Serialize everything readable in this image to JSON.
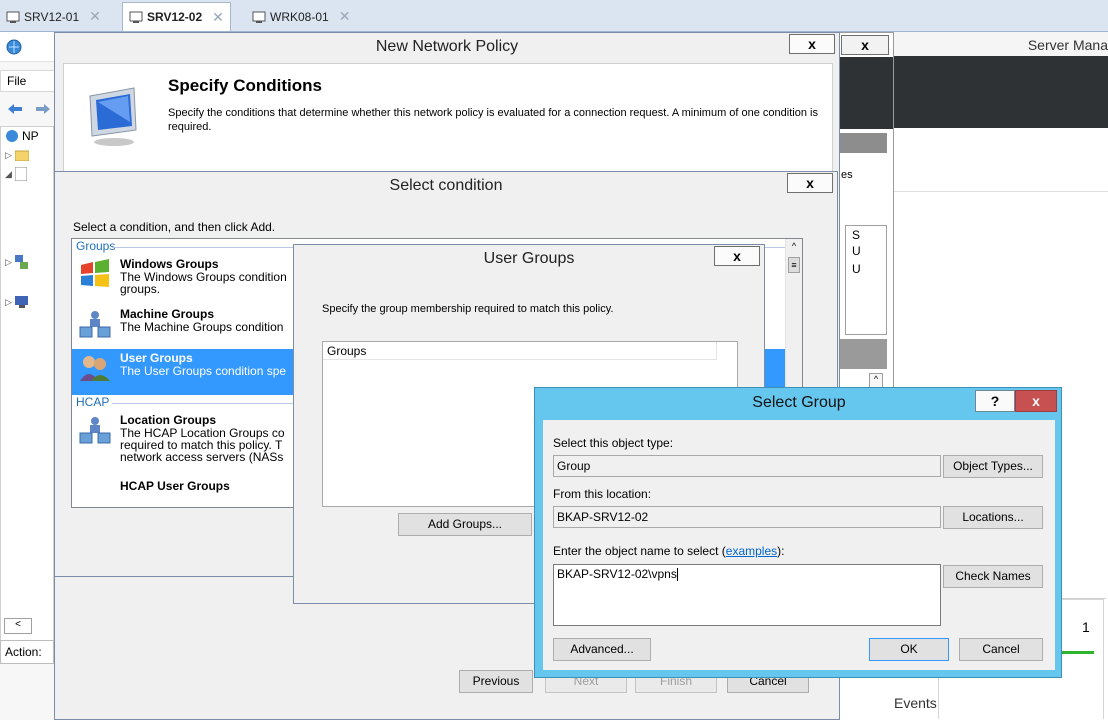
{
  "vm_tabs": [
    {
      "label": "SRV12-01",
      "active": false
    },
    {
      "label": "SRV12-02",
      "active": true
    },
    {
      "label": "WRK08-01",
      "active": false
    }
  ],
  "mmc": {
    "menu_file": "File",
    "tree_root": "NP",
    "status_label": "Action:"
  },
  "server_manager": {
    "title": "Server Mana",
    "list_header_fragment": "es",
    "col_items": [
      "S",
      "U",
      "U"
    ],
    "events_label": "Events",
    "tile_count": "1"
  },
  "new_network_policy": {
    "title": "New Network Policy",
    "close": "x",
    "heading": "Specify Conditions",
    "description": "Specify the conditions that determine whether this network policy is evaluated for a connection request. A minimum of one condition is required.",
    "buttons": {
      "previous": "Previous",
      "next": "Next",
      "finish": "Finish",
      "cancel": "Cancel"
    }
  },
  "select_condition": {
    "title": "Select condition",
    "close": "x",
    "instruction": "Select a condition, and then click Add.",
    "categories": {
      "groups": "Groups",
      "hcap": "HCAP"
    },
    "items": [
      {
        "title": "Windows Groups",
        "desc": "The Windows Groups condition",
        "desc2": "groups."
      },
      {
        "title": "Machine Groups",
        "desc": "The Machine Groups condition"
      },
      {
        "title": "User Groups",
        "desc": "The User Groups condition spe"
      },
      {
        "title": "Location Groups",
        "desc": "The HCAP Location Groups co",
        "desc2": "required to match this policy. T",
        "desc3": "network access servers (NASs"
      },
      {
        "title": "HCAP User Groups",
        "desc": ""
      }
    ]
  },
  "user_groups": {
    "title": "User Groups",
    "close": "x",
    "instruction": "Specify the group membership required to match this policy.",
    "column_header": "Groups",
    "add_button": "Add Groups..."
  },
  "select_group": {
    "title": "Select Group",
    "help": "?",
    "close": "x",
    "object_type_label": "Select this object type:",
    "object_type_value": "Group",
    "object_types_button": "Object Types...",
    "location_label": "From this location:",
    "location_value": "BKAP-SRV12-02",
    "locations_button": "Locations...",
    "enter_label_prefix": "Enter the object name to select (",
    "examples_link": "examples",
    "enter_label_suffix": "):",
    "object_name_value": "BKAP-SRV12-02\\vpns",
    "check_names_button": "Check Names",
    "advanced_button": "Advanced...",
    "ok_button": "OK",
    "cancel_button": "Cancel"
  },
  "colors": {
    "select_group_frame": "#66c7ee",
    "selection": "#3399ff",
    "close_red": "#c75050",
    "status_green": "#2db42d"
  }
}
